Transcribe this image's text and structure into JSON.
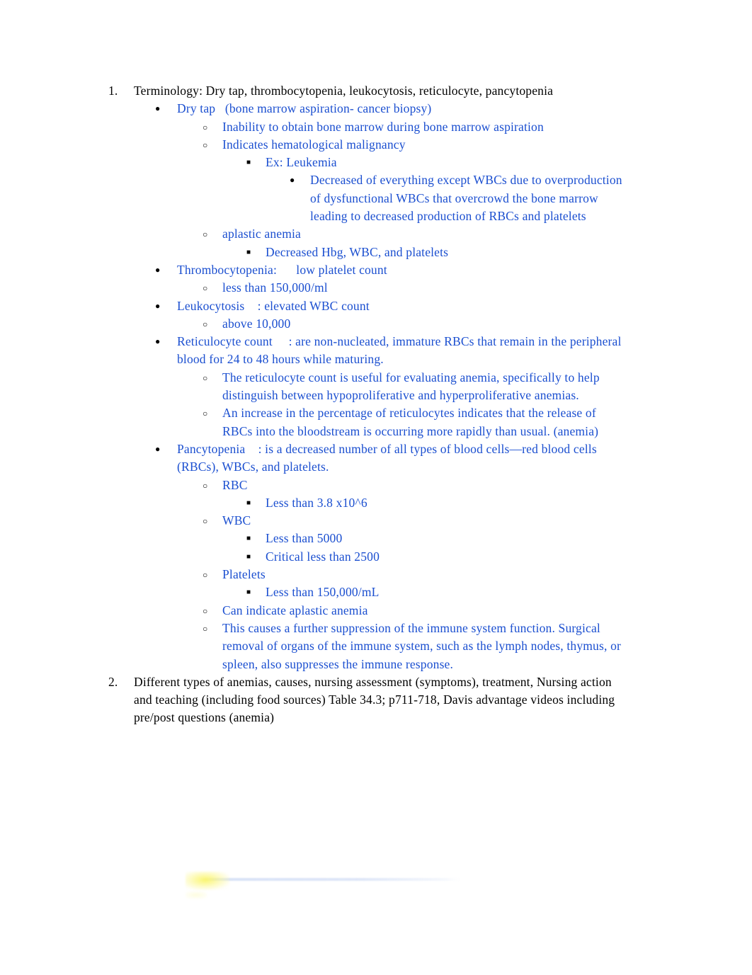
{
  "document": {
    "text_color_primary": "#000000",
    "text_color_accent": "#1b4fd0",
    "background": "#ffffff"
  },
  "outline": {
    "item1_marker": "1.",
    "item1_text": "Terminology: Dry tap, thrombocytopenia, leukocytosis, reticulocyte, pancytopenia",
    "dry_tap": "Dry tap   (bone marrow aspiration- cancer biopsy)",
    "inability": "Inability to obtain bone marrow during bone marrow aspiration",
    "indicates": "Indicates hematological malignancy",
    "ex_leukemia": "Ex: Leukemia",
    "decreased_everything": "Decreased of everything except WBCs due to overproduction of dysfunctional WBCs that overcrowd the bone marrow leading to decreased production of RBCs and platelets",
    "aplastic_anemia": "aplastic anemia",
    "decreased_hbg": "Decreased Hbg, WBC, and platelets",
    "thrombocytopenia": "Thrombocytopenia:      low platelet count",
    "less_than_150000_ml": "less than 150,000/ml",
    "leukocytosis": "Leukocytosis    : elevated WBC count",
    "above_10000": "above 10,000",
    "reticulocyte_count": "Reticulocyte count     : are non-nucleated, immature RBCs that remain in the peripheral blood for 24 to 48 hours while maturing.",
    "retic_useful": "The reticulocyte count is useful for evaluating anemia, specifically to help distinguish between hypoproliferative and hyperproliferative anemias.",
    "retic_increase": "An increase in the percentage of reticulocytes indicates that the release of RBCs into the bloodstream is occurring more rapidly than usual. (anemia)",
    "pancytopenia": "Pancytopenia    : is a decreased number of all types of blood cells—red blood cells (RBCs), WBCs, and platelets.",
    "rbc": "RBC",
    "rbc_value": "Less than 3.8 x10^6",
    "wbc": "WBC",
    "wbc_value": "Less than 5000",
    "wbc_critical": "Critical less than 2500",
    "platelets": "Platelets",
    "platelets_value": "Less than 150,000/mL",
    "can_indicate": "Can indicate aplastic anemia",
    "further_suppression": "This causes a further suppression of the immune system function. Surgical removal of organs of the immune system, such as the lymph nodes, thymus, or spleen, also suppresses the immune response.",
    "item2_marker": "2.",
    "item2_text": "Different types of anemias, causes, nursing assessment (symptoms), treatment, Nursing action and teaching (including food sources) Table 34.3; p711-718, Davis advantage videos including pre/post questions (anemia)"
  },
  "markers": {
    "disc": "●",
    "circle": "○",
    "square": "■"
  }
}
